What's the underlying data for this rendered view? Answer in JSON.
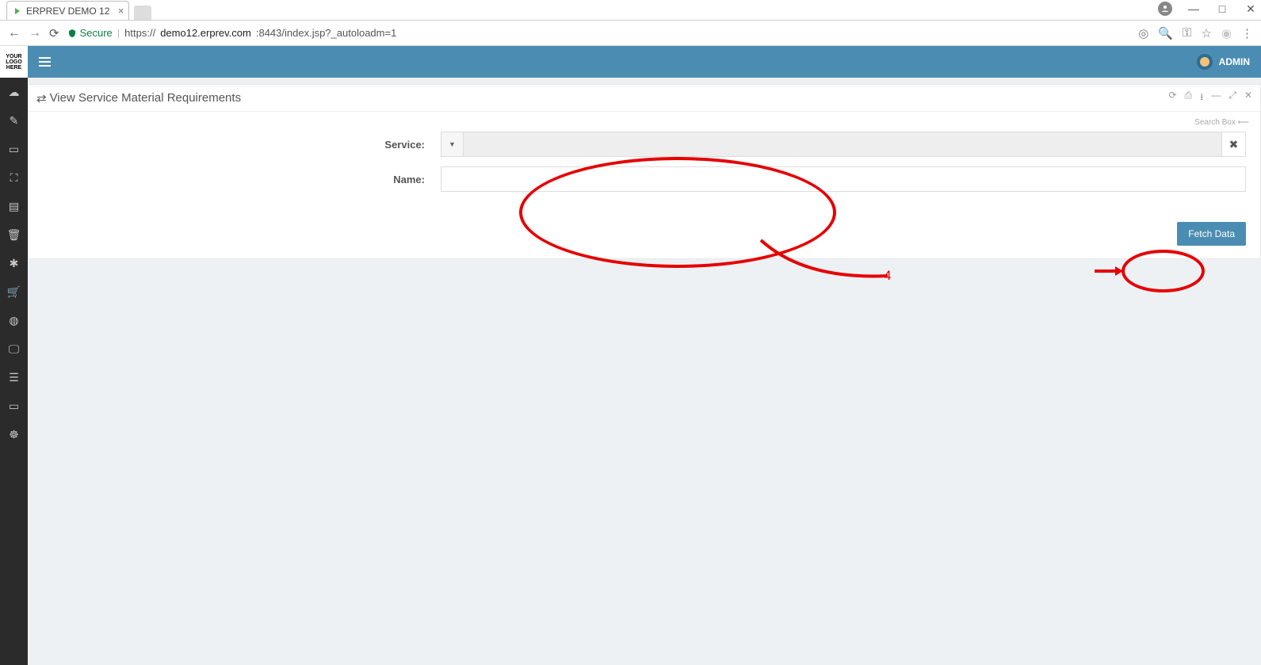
{
  "browser": {
    "tab_title": "ERPREV DEMO 12",
    "secure_label": "Secure",
    "url_prefix": "https://",
    "url_domain": "demo12.erprev.com",
    "url_port_path": ":8443/index.jsp?_autoloadm=1"
  },
  "app": {
    "logo_lines": [
      "YOUR",
      "LOGO",
      "HERE"
    ],
    "user_label": "ADMIN",
    "panel_title": "View Service Material Requirements",
    "searchbox_label": "Search Box",
    "form": {
      "service_label": "Service:",
      "service_value": "",
      "name_label": "Name:",
      "name_value": ""
    },
    "fetch_button": "Fetch Data"
  },
  "annotations": {
    "step_number": "4"
  },
  "sidebar_icons": [
    "dashboard-icon",
    "tag-icon",
    "money-icon",
    "modules-icon",
    "doc-icon",
    "trash-icon",
    "gear-icon",
    "cart-icon",
    "globe-icon",
    "monitor-icon",
    "db-icon",
    "book-icon",
    "support-icon"
  ],
  "panel_tool_icons": [
    "refresh-icon",
    "print-icon",
    "download-icon",
    "minimize-icon",
    "expand-icon",
    "close-icon"
  ]
}
